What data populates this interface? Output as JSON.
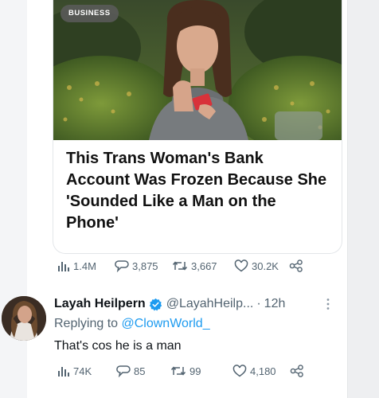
{
  "article_card": {
    "badge": "BUSINESS",
    "headline": "This Trans Woman's Bank Account Was Frozen Because She 'Sounded Like a Man on the Phone'"
  },
  "original_post": {
    "views": "1.4M",
    "replies": "3,875",
    "reposts": "3,667",
    "likes": "30.2K"
  },
  "reply_post": {
    "display_name": "Layah Heilpern",
    "handle": "@LayahHeilp...",
    "separator": "·",
    "time": "12h",
    "replying_label": "Replying to",
    "replying_to": "@ClownWorld_",
    "text": "That's cos he is a man",
    "views": "74K",
    "replies": "85",
    "reposts": "99",
    "likes": "4,180"
  },
  "icons": {
    "views": "bar-chart-icon",
    "replies": "speech-bubble-icon",
    "reposts": "repost-arrows-icon",
    "likes": "heart-icon",
    "share": "share-icon",
    "verified": "verified-badge-icon",
    "more": "more-dots-icon"
  },
  "colors": {
    "text_primary": "#0f1419",
    "text_secondary": "#536471",
    "link": "#1d9bf0",
    "verified": "#1d9bf0"
  }
}
